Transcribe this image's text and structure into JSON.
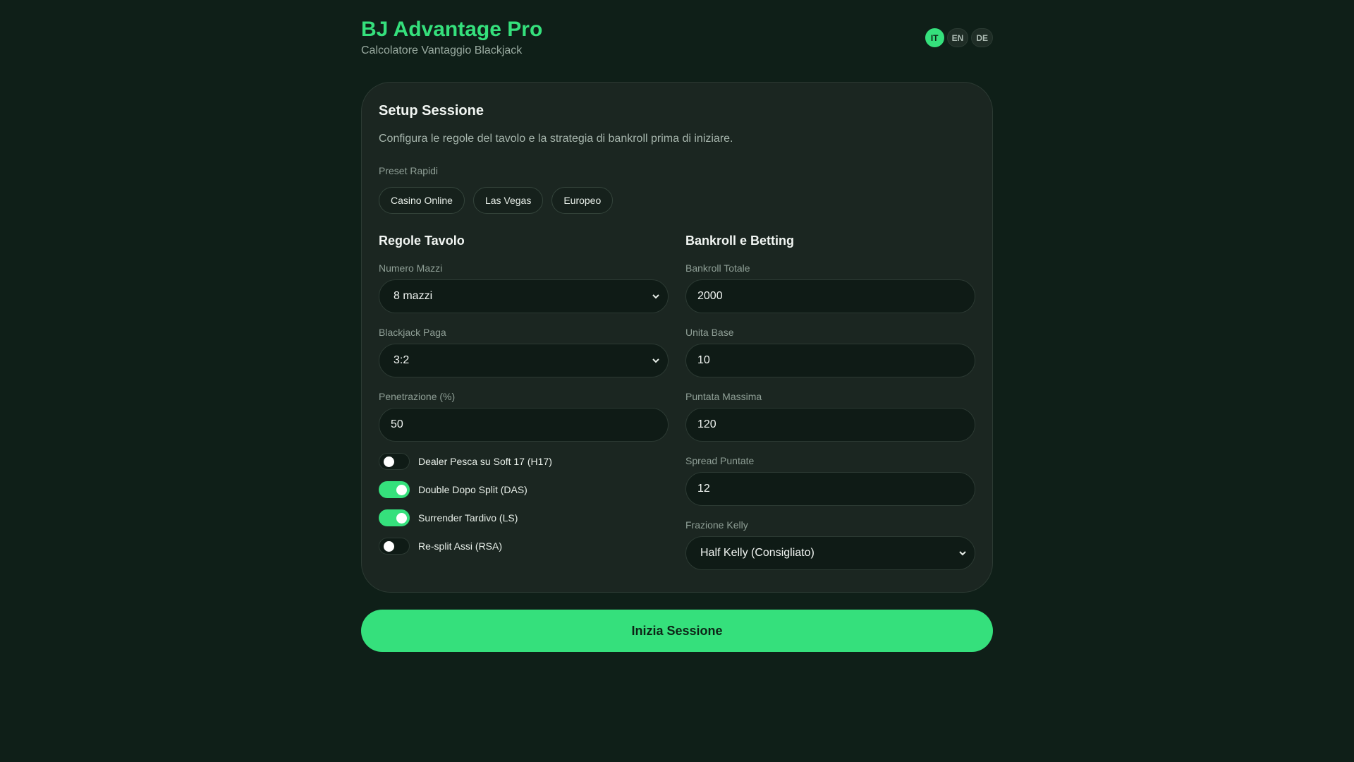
{
  "header": {
    "title": "BJ Advantage Pro",
    "subtitle": "Calcolatore Vantaggio Blackjack",
    "languages": [
      {
        "code": "IT",
        "active": true
      },
      {
        "code": "EN",
        "active": false
      },
      {
        "code": "DE",
        "active": false
      }
    ]
  },
  "setup": {
    "title": "Setup Sessione",
    "description": "Configura le regole del tavolo e la strategia di bankroll prima di iniziare.",
    "presets_label": "Preset Rapidi",
    "presets": [
      "Casino Online",
      "Las Vegas",
      "Europeo"
    ]
  },
  "table_rules": {
    "title": "Regole Tavolo",
    "decks": {
      "label": "Numero Mazzi",
      "value": "8 mazzi"
    },
    "blackjack_pays": {
      "label": "Blackjack Paga",
      "value": "3:2"
    },
    "penetration": {
      "label": "Penetrazione (%)",
      "value": "50"
    },
    "toggles": [
      {
        "label": "Dealer Pesca su Soft 17 (H17)",
        "on": false
      },
      {
        "label": "Double Dopo Split (DAS)",
        "on": true
      },
      {
        "label": "Surrender Tardivo (LS)",
        "on": true
      },
      {
        "label": "Re-split Assi (RSA)",
        "on": false
      }
    ]
  },
  "bankroll": {
    "title": "Bankroll e Betting",
    "total": {
      "label": "Bankroll Totale",
      "value": "2000"
    },
    "base_unit": {
      "label": "Unita Base",
      "value": "10"
    },
    "max_bet": {
      "label": "Puntata Massima",
      "value": "120"
    },
    "bet_spread": {
      "label": "Spread Puntate",
      "value": "12"
    },
    "kelly": {
      "label": "Frazione Kelly",
      "value": "Half Kelly (Consigliato)"
    }
  },
  "actions": {
    "start_label": "Inizia Sessione"
  },
  "colors": {
    "accent": "#35e07c",
    "background": "#0f1f18",
    "card": "#1b2621"
  }
}
